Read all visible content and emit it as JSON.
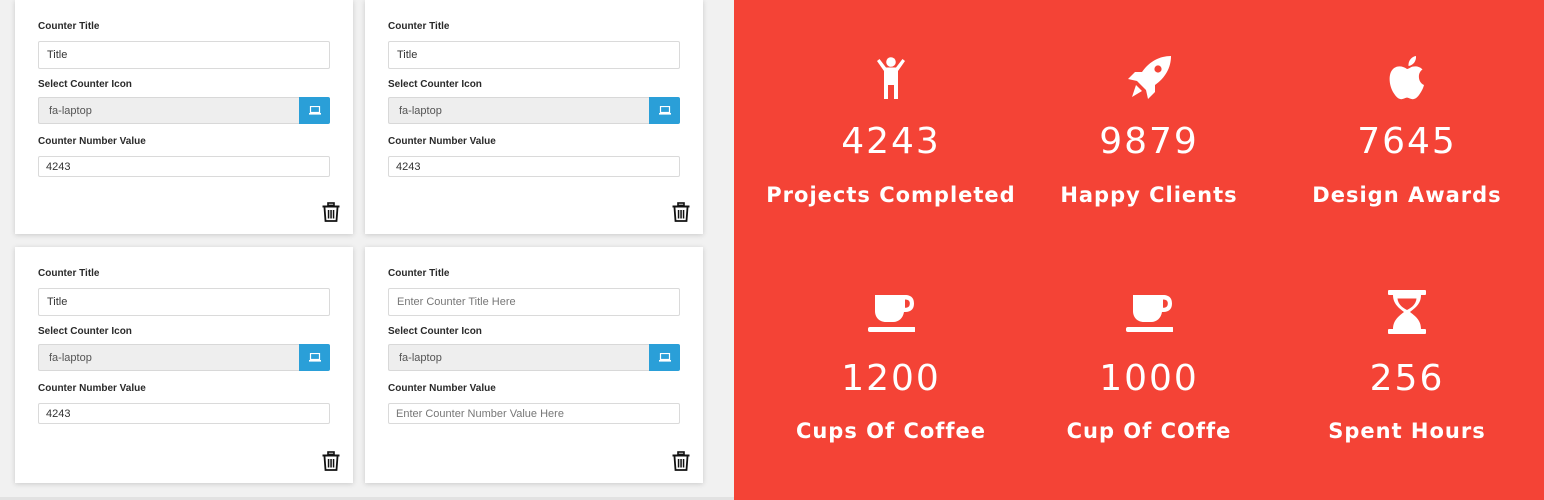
{
  "editor": {
    "cards": [
      {
        "title_label": "Counter Title",
        "title_value": "Title",
        "title_placeholder": "Enter Counter Title Here",
        "icon_label": "Select Counter Icon",
        "icon_value": "fa-laptop",
        "number_label": "Counter Number Value",
        "number_value": "4243",
        "number_placeholder": "Enter Counter Number Value Here"
      },
      {
        "title_label": "Counter Title",
        "title_value": "Title",
        "title_placeholder": "Enter Counter Title Here",
        "icon_label": "Select Counter Icon",
        "icon_value": "fa-laptop",
        "number_label": "Counter Number Value",
        "number_value": "4243",
        "number_placeholder": "Enter Counter Number Value Here"
      },
      {
        "title_label": "Counter Title",
        "title_value": "Title",
        "title_placeholder": "Enter Counter Title Here",
        "icon_label": "Select Counter Icon",
        "icon_value": "fa-laptop",
        "number_label": "Counter Number Value",
        "number_value": "4243",
        "number_placeholder": "Enter Counter Number Value Here"
      },
      {
        "title_label": "Counter Title",
        "title_value": "",
        "title_placeholder": "Enter Counter Title Here",
        "icon_label": "Select Counter Icon",
        "icon_value": "fa-laptop",
        "number_label": "Counter Number Value",
        "number_value": "",
        "number_placeholder": "Enter Counter Number Value Here"
      }
    ],
    "icon_button_icon": "laptop-icon",
    "delete_icon": "trash-icon"
  },
  "preview": {
    "background": "#f44336",
    "stats": [
      {
        "icon": "child-icon",
        "number": "4243",
        "label": "Projects Completed"
      },
      {
        "icon": "rocket-icon",
        "number": "9879",
        "label": "Happy Clients"
      },
      {
        "icon": "apple-icon",
        "number": "7645",
        "label": "Design Awards"
      },
      {
        "icon": "coffee-cup-icon",
        "number": "1200",
        "label": "Cups Of Coffee"
      },
      {
        "icon": "coffee-cup-icon",
        "number": "1000",
        "label": "Cup Of COffe"
      },
      {
        "icon": "hourglass-icon",
        "number": "256",
        "label": "Spent Hours"
      }
    ]
  },
  "colors": {
    "accent": "#2a9fd8",
    "preview_bg": "#f44336"
  }
}
